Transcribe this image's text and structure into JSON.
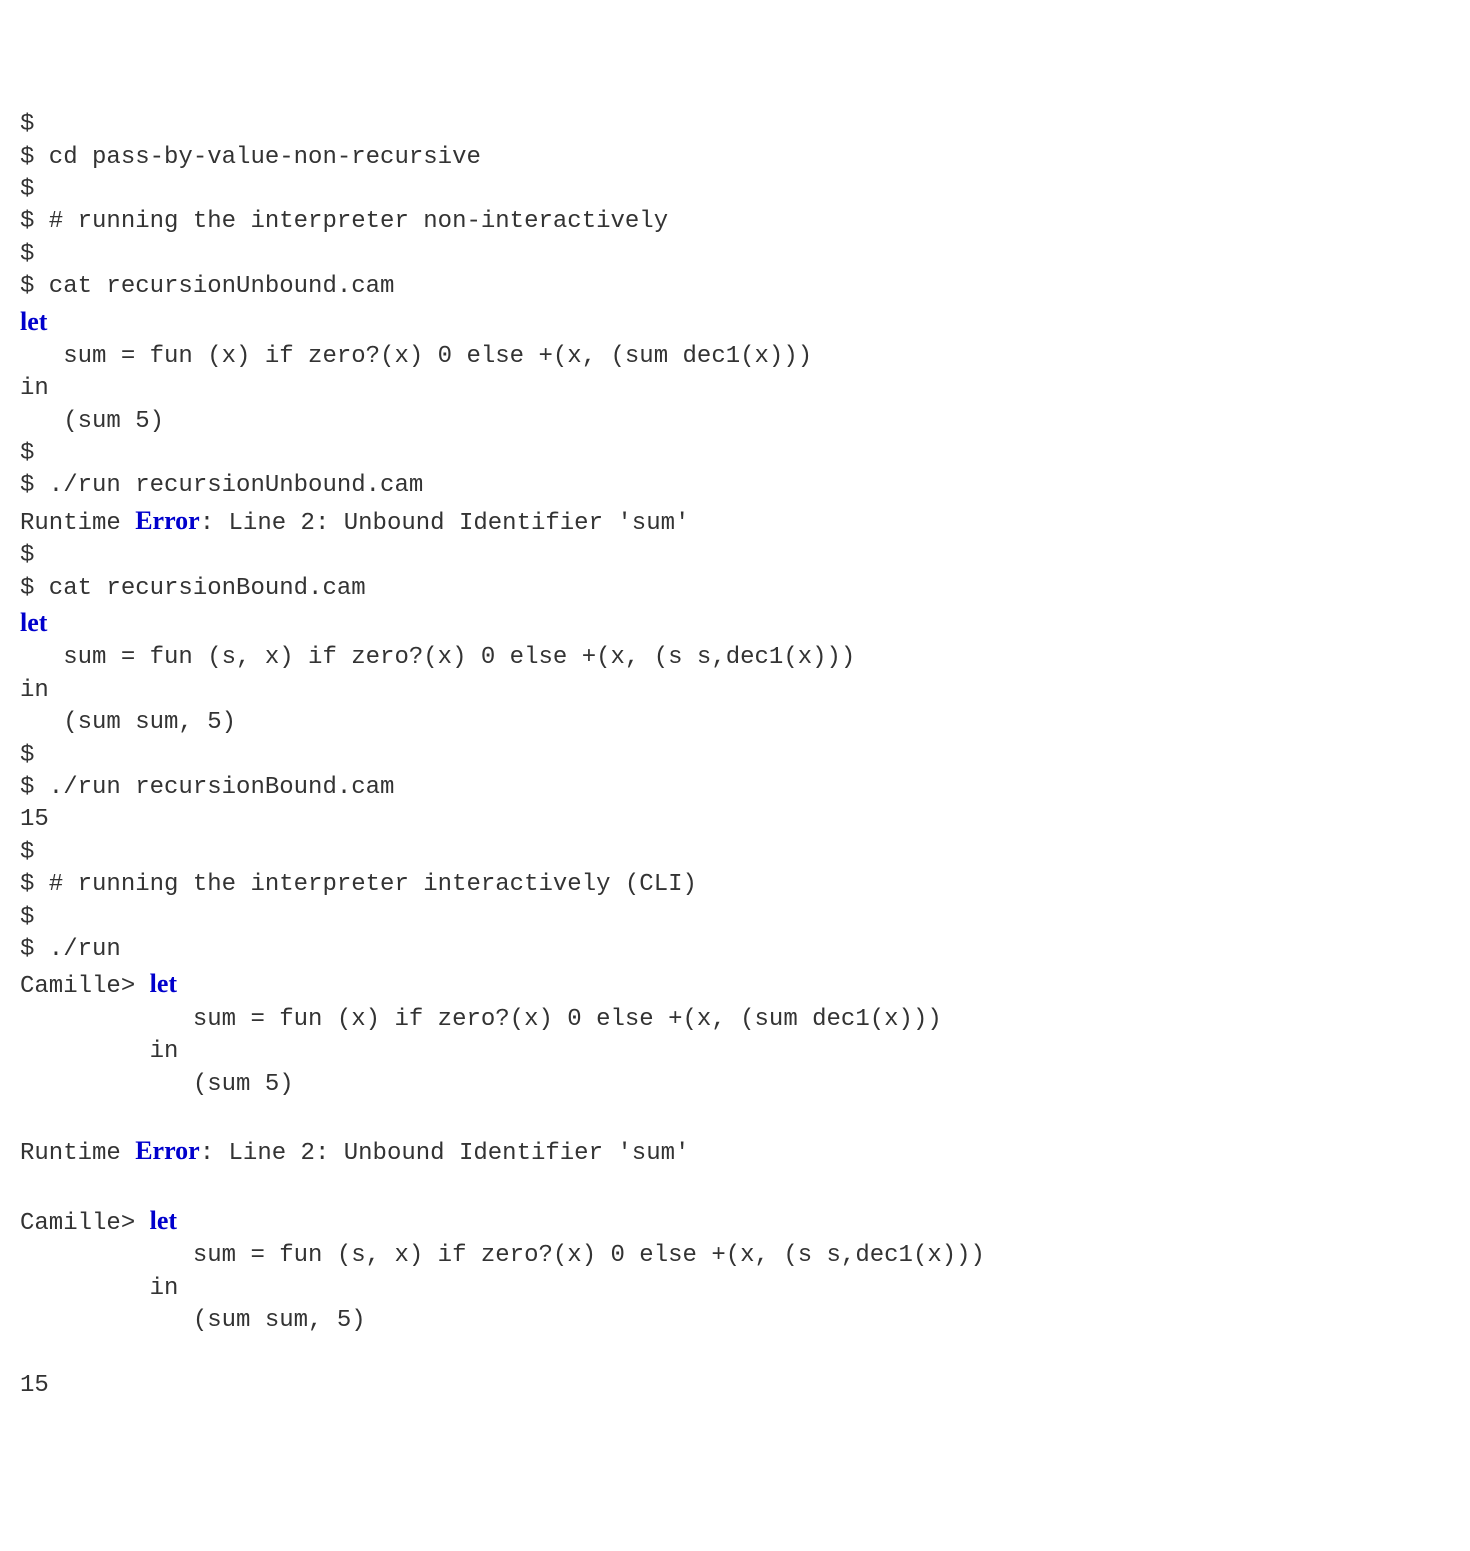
{
  "lines": [
    [
      {
        "t": "$"
      }
    ],
    [
      {
        "t": "$ cd pass-by-value-non-recursive"
      }
    ],
    [
      {
        "t": "$"
      }
    ],
    [
      {
        "t": "$ # running the interpreter non-interactively"
      }
    ],
    [
      {
        "t": "$"
      }
    ],
    [
      {
        "t": "$ cat recursionUnbound.cam"
      }
    ],
    [
      {
        "t": "let",
        "kw": true
      }
    ],
    [
      {
        "t": "   sum = fun (x) if zero?(x) 0 else +(x, (sum dec1(x)))"
      }
    ],
    [
      {
        "t": "in"
      }
    ],
    [
      {
        "t": "   (sum 5)"
      }
    ],
    [
      {
        "t": "$"
      }
    ],
    [
      {
        "t": "$ ./run recursionUnbound.cam"
      }
    ],
    [
      {
        "t": "Runtime "
      },
      {
        "t": "Error",
        "kw": true
      },
      {
        "t": ": Line 2: Unbound Identifier 'sum'"
      }
    ],
    [
      {
        "t": "$"
      }
    ],
    [
      {
        "t": "$ cat recursionBound.cam"
      }
    ],
    [
      {
        "t": "let",
        "kw": true
      }
    ],
    [
      {
        "t": "   sum = fun (s, x) if zero?(x) 0 else +(x, (s s,dec1(x)))"
      }
    ],
    [
      {
        "t": "in"
      }
    ],
    [
      {
        "t": "   (sum sum, 5)"
      }
    ],
    [
      {
        "t": "$"
      }
    ],
    [
      {
        "t": "$ ./run recursionBound.cam"
      }
    ],
    [
      {
        "t": "15"
      }
    ],
    [
      {
        "t": "$"
      }
    ],
    [
      {
        "t": "$ # running the interpreter interactively (CLI)"
      }
    ],
    [
      {
        "t": "$"
      }
    ],
    [
      {
        "t": "$ ./run"
      }
    ],
    [
      {
        "t": "Camille> "
      },
      {
        "t": "let",
        "kw": true
      }
    ],
    [
      {
        "t": "            sum = fun (x) if zero?(x) 0 else +(x, (sum dec1(x)))"
      }
    ],
    [
      {
        "t": "         in"
      }
    ],
    [
      {
        "t": "            (sum 5)"
      }
    ],
    [
      {
        "t": ""
      }
    ],
    [
      {
        "t": "Runtime "
      },
      {
        "t": "Error",
        "kw": true
      },
      {
        "t": ": Line 2: Unbound Identifier 'sum'"
      }
    ],
    [
      {
        "t": ""
      }
    ],
    [
      {
        "t": "Camille> "
      },
      {
        "t": "let",
        "kw": true
      }
    ],
    [
      {
        "t": "            sum = fun (s, x) if zero?(x) 0 else +(x, (s s,dec1(x)))"
      }
    ],
    [
      {
        "t": "         in"
      }
    ],
    [
      {
        "t": "            (sum sum, 5)"
      }
    ],
    [
      {
        "t": ""
      }
    ],
    [
      {
        "t": "15"
      }
    ]
  ]
}
